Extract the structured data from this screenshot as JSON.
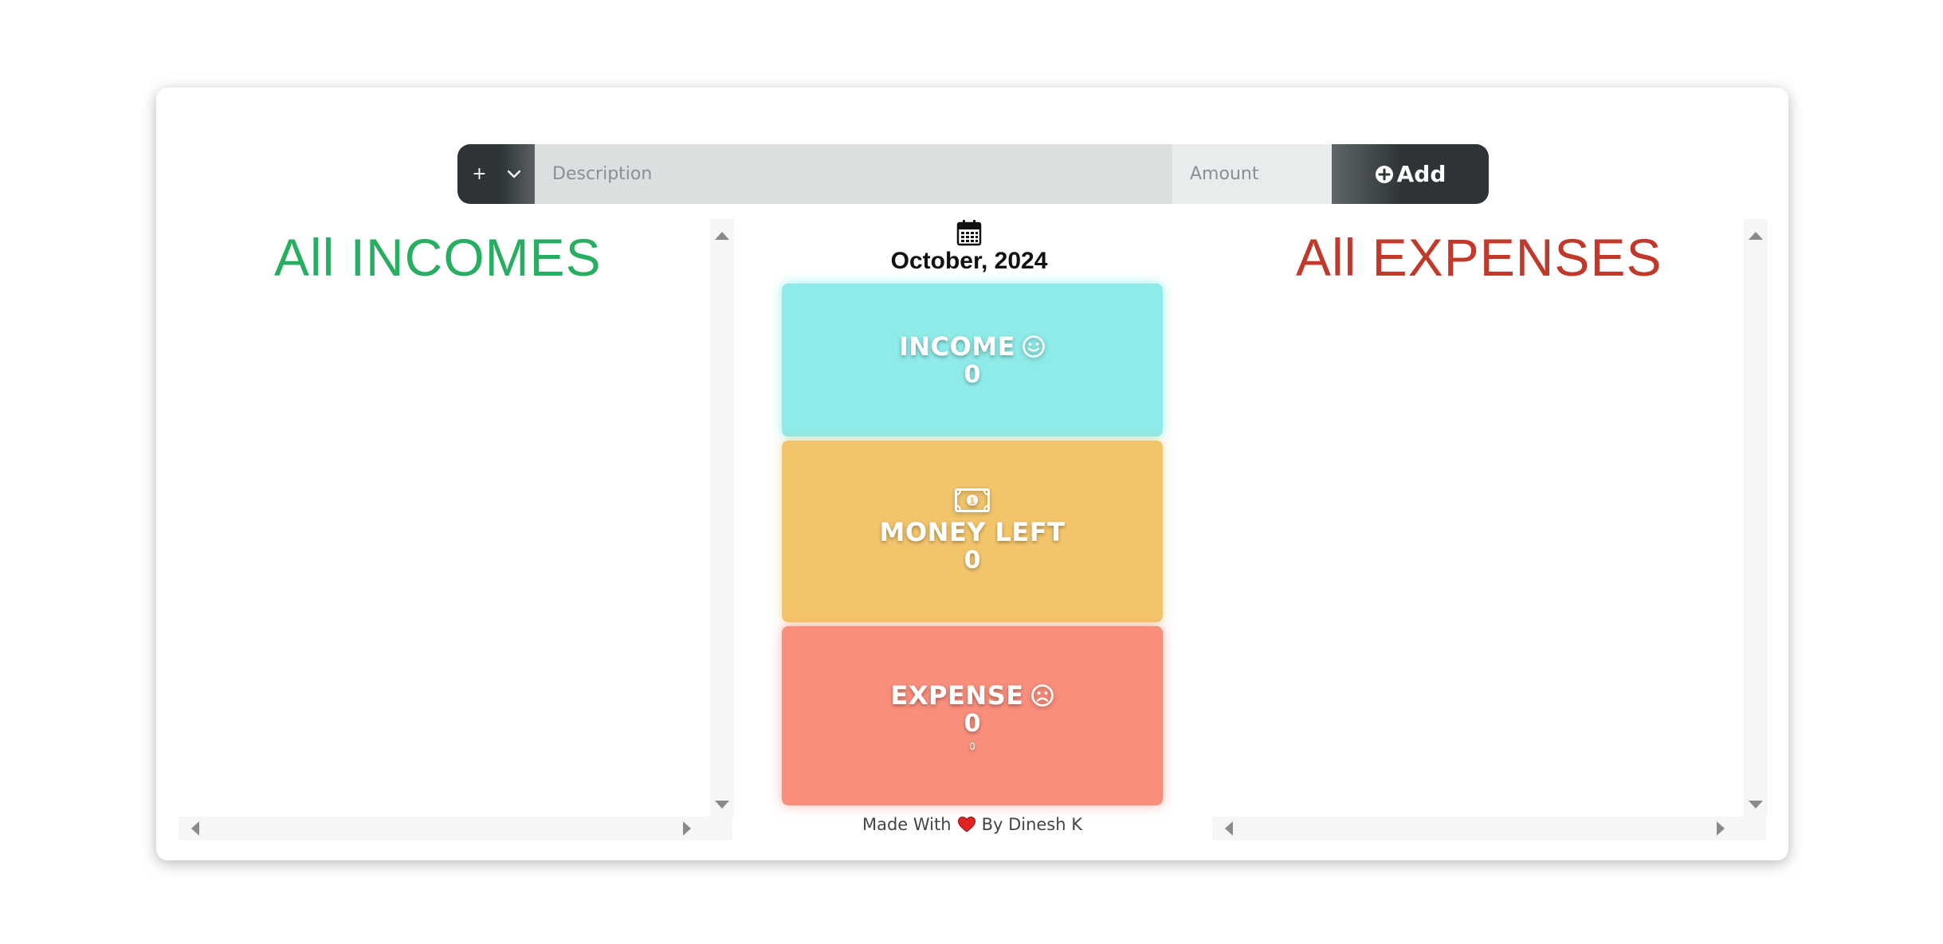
{
  "entry_form": {
    "type_symbol": "+",
    "description_placeholder": "Description",
    "amount_placeholder": "Amount",
    "add_label": "Add"
  },
  "incomes_panel": {
    "title": "All INCOMES",
    "title_color": "#27ae60"
  },
  "expenses_panel": {
    "title": "All EXPENSES",
    "title_color": "#c0392b"
  },
  "summary": {
    "date": "October, 2024",
    "income": {
      "label": "INCOME",
      "value": "0",
      "icon": "smile-icon",
      "color": "#8eebe8"
    },
    "money_left": {
      "label": "MONEY LEFT",
      "value": "0",
      "icon": "money-bill-icon",
      "color": "#f3c56b"
    },
    "expense": {
      "label": "EXPENSE",
      "value": "0",
      "subvalue": "0",
      "icon": "frown-icon",
      "color": "#f98e7c"
    }
  },
  "footer": {
    "made_with": "Made With",
    "by": "By Dinesh K",
    "heart_color": "#e52222"
  }
}
